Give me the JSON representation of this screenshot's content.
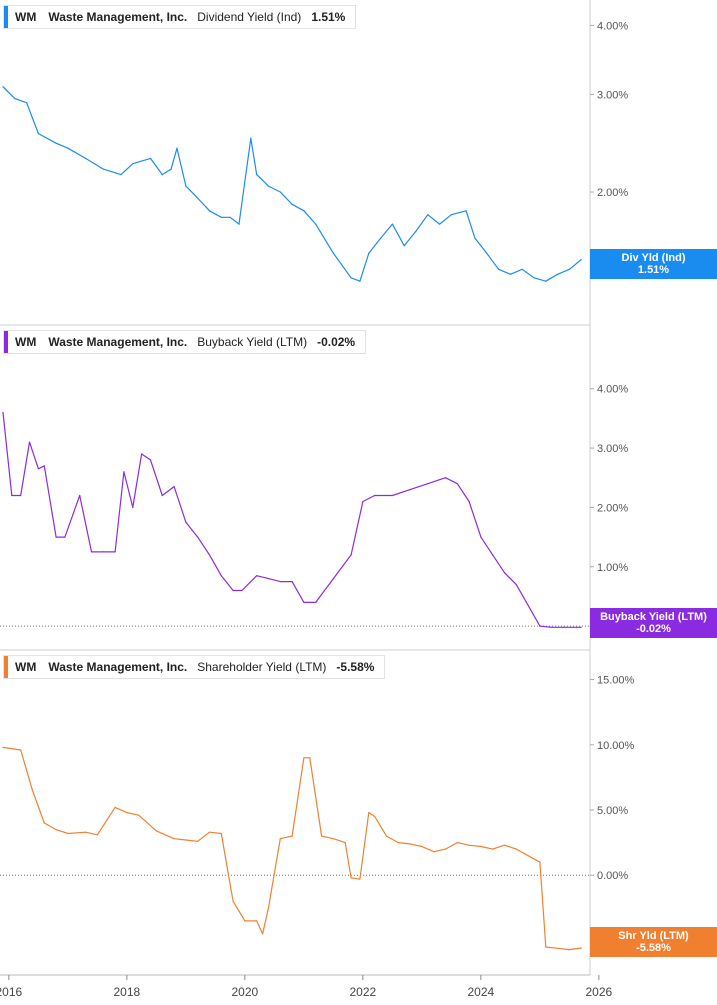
{
  "chart_data": [
    {
      "type": "line",
      "ticker": "WM",
      "company": "Waste Management, Inc.",
      "metric": "Dividend Yield (Ind)",
      "current_value": "1.51%",
      "badge_lines": [
        "Div Yld (Ind)",
        "1.51%"
      ],
      "color": "#1a8cf0",
      "y_scale": "log",
      "ylim": [
        1.25,
        4.3
      ],
      "yticks": [
        2.0,
        3.0,
        4.0
      ],
      "ytick_labels": [
        "2.00%",
        "3.00%",
        "4.00%"
      ],
      "x": [
        2015.9,
        2016.1,
        2016.3,
        2016.5,
        2016.8,
        2017.0,
        2017.3,
        2017.6,
        2017.9,
        2018.1,
        2018.4,
        2018.6,
        2018.75,
        2018.85,
        2019.0,
        2019.2,
        2019.4,
        2019.6,
        2019.75,
        2019.9,
        2020.1,
        2020.2,
        2020.4,
        2020.6,
        2020.8,
        2021.0,
        2021.2,
        2021.5,
        2021.8,
        2021.95,
        2022.1,
        2022.3,
        2022.5,
        2022.7,
        2022.9,
        2023.1,
        2023.3,
        2023.5,
        2023.75,
        2023.9,
        2024.1,
        2024.3,
        2024.5,
        2024.7,
        2024.9,
        2025.1,
        2025.3,
        2025.5,
        2025.7
      ],
      "y": [
        3.1,
        2.95,
        2.9,
        2.55,
        2.45,
        2.4,
        2.3,
        2.2,
        2.15,
        2.25,
        2.3,
        2.15,
        2.2,
        2.4,
        2.05,
        1.95,
        1.85,
        1.8,
        1.8,
        1.75,
        2.5,
        2.15,
        2.05,
        2.0,
        1.9,
        1.85,
        1.75,
        1.55,
        1.4,
        1.38,
        1.55,
        1.65,
        1.75,
        1.6,
        1.7,
        1.82,
        1.75,
        1.82,
        1.85,
        1.65,
        1.55,
        1.45,
        1.42,
        1.45,
        1.4,
        1.38,
        1.42,
        1.45,
        1.51
      ]
    },
    {
      "type": "line",
      "ticker": "WM",
      "company": "Waste Management, Inc.",
      "metric": "Buyback Yield (LTM)",
      "current_value": "-0.02%",
      "badge_lines": [
        "Buyback Yield (LTM)",
        "-0.02%"
      ],
      "color": "#8a2be2",
      "ylim": [
        -0.15,
        4.4
      ],
      "yticks": [
        1.0,
        2.0,
        3.0,
        4.0
      ],
      "ytick_labels": [
        "1.00%",
        "2.00%",
        "3.00%",
        "4.00%"
      ],
      "x": [
        2015.9,
        2016.05,
        2016.2,
        2016.35,
        2016.5,
        2016.6,
        2016.8,
        2016.95,
        2017.2,
        2017.4,
        2017.6,
        2017.8,
        2017.95,
        2018.1,
        2018.25,
        2018.4,
        2018.6,
        2018.8,
        2019.0,
        2019.2,
        2019.4,
        2019.6,
        2019.8,
        2019.95,
        2020.2,
        2020.4,
        2020.6,
        2020.8,
        2021.0,
        2021.2,
        2021.5,
        2021.8,
        2022.0,
        2022.2,
        2022.5,
        2022.8,
        2023.1,
        2023.4,
        2023.6,
        2023.8,
        2024.0,
        2024.2,
        2024.4,
        2024.6,
        2024.8,
        2025.0,
        2025.2,
        2025.4,
        2025.7
      ],
      "y": [
        3.6,
        2.2,
        2.2,
        3.1,
        2.65,
        2.7,
        1.5,
        1.5,
        2.2,
        1.25,
        1.25,
        1.25,
        2.6,
        2.0,
        2.9,
        2.8,
        2.2,
        2.35,
        1.75,
        1.5,
        1.2,
        0.85,
        0.6,
        0.6,
        0.85,
        0.8,
        0.75,
        0.75,
        0.4,
        0.4,
        0.8,
        1.2,
        2.1,
        2.2,
        2.2,
        2.3,
        2.4,
        2.5,
        2.4,
        2.1,
        1.5,
        1.2,
        0.9,
        0.7,
        0.35,
        0.0,
        -0.02,
        -0.02,
        -0.02
      ]
    },
    {
      "type": "line",
      "ticker": "WM",
      "company": "Waste Management, Inc.",
      "metric": "Shareholder Yield (LTM)",
      "current_value": "-5.58%",
      "badge_lines": [
        "Shr Yld (LTM)",
        "-5.58%"
      ],
      "color": "#f08030",
      "ylim": [
        -6.5,
        16.5
      ],
      "yticks": [
        0.0,
        5.0,
        10.0,
        15.0
      ],
      "ytick_labels": [
        "0.00%",
        "5.00%",
        "10.00%",
        "15.00%"
      ],
      "x": [
        2015.9,
        2016.2,
        2016.4,
        2016.6,
        2016.8,
        2017.0,
        2017.3,
        2017.5,
        2017.8,
        2018.0,
        2018.2,
        2018.5,
        2018.8,
        2019.0,
        2019.2,
        2019.4,
        2019.6,
        2019.8,
        2020.0,
        2020.2,
        2020.3,
        2020.4,
        2020.6,
        2020.8,
        2021.0,
        2021.1,
        2021.3,
        2021.5,
        2021.7,
        2021.8,
        2021.95,
        2022.1,
        2022.2,
        2022.4,
        2022.6,
        2022.8,
        2023.0,
        2023.2,
        2023.4,
        2023.6,
        2023.8,
        2024.0,
        2024.2,
        2024.4,
        2024.6,
        2024.8,
        2025.0,
        2025.1,
        2025.3,
        2025.5,
        2025.7
      ],
      "y": [
        9.8,
        9.6,
        6.5,
        4.0,
        3.5,
        3.2,
        3.3,
        3.1,
        5.2,
        4.8,
        4.6,
        3.4,
        2.8,
        2.7,
        2.6,
        3.3,
        3.2,
        -2.0,
        -3.5,
        -3.5,
        -4.5,
        -2.5,
        2.8,
        3.0,
        9.0,
        9.0,
        3.0,
        2.8,
        2.5,
        -0.2,
        -0.3,
        4.8,
        4.5,
        3.0,
        2.5,
        2.4,
        2.2,
        1.8,
        2.0,
        2.5,
        2.3,
        2.2,
        2.0,
        2.3,
        2.0,
        1.5,
        1.0,
        -5.5,
        -5.6,
        -5.7,
        -5.58
      ]
    }
  ],
  "x_axis": {
    "range": [
      2015.85,
      2025.85
    ],
    "ticks": [
      2016,
      2018,
      2020,
      2022,
      2024,
      2026
    ],
    "tick_labels": [
      "2016",
      "2018",
      "2020",
      "2022",
      "2024",
      "2026"
    ]
  }
}
